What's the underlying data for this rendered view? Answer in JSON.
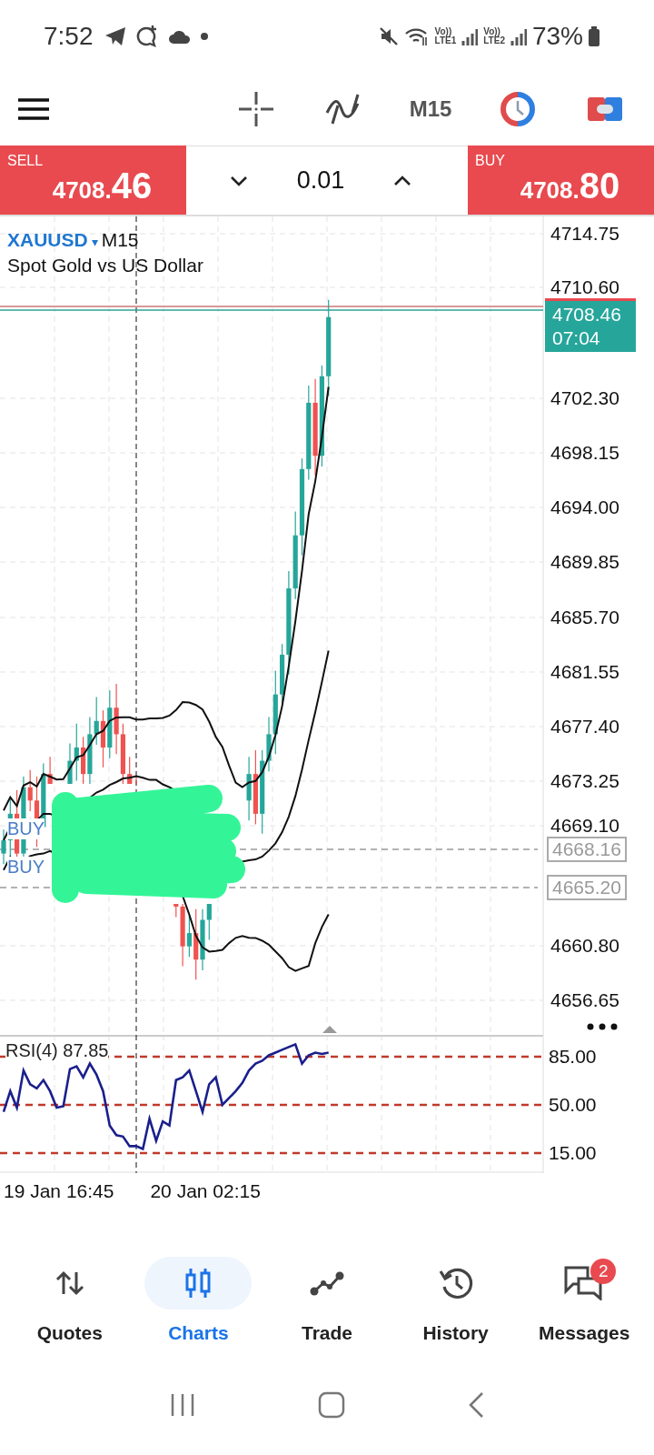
{
  "status_bar": {
    "time": "7:52",
    "sims": [
      {
        "volte": "Vo))",
        "network": "LTE1"
      },
      {
        "volte": "Vo))",
        "network": "LTE2"
      }
    ],
    "battery": "73%"
  },
  "toolbar": {
    "timeframe": "M15"
  },
  "trade_bar": {
    "sell": {
      "label": "SELL",
      "price_prefix": "4708.",
      "price_pips": "46"
    },
    "volume": "0.01",
    "buy": {
      "label": "BUY",
      "price_prefix": "4708.",
      "price_pips": "80"
    }
  },
  "chart": {
    "symbol": "XAUUSD",
    "dropdown": "▾",
    "timeframe": "M15",
    "description": "Spot Gold vs US Dollar",
    "price_axis": [
      "4714.75",
      "4710.60",
      "4702.30",
      "4698.15",
      "4694.00",
      "4689.85",
      "4685.70",
      "4681.55",
      "4677.40",
      "4673.25",
      "4669.10",
      "4660.80",
      "4656.65"
    ],
    "current_price": {
      "price": "4708.46",
      "countdown": "07:04"
    },
    "orders": [
      {
        "label": "BUY",
        "price": "4668.16"
      },
      {
        "label": "BUY",
        "price": "4665.20"
      }
    ]
  },
  "rsi": {
    "label": "RSI(4) 87.85",
    "levels": [
      "85.00",
      "50.00",
      "15.00"
    ]
  },
  "time_axis": [
    "19 Jan 16:45",
    "20 Jan 02:15"
  ],
  "nav": [
    {
      "kind": "quotes",
      "label": "Quotes",
      "selected": false
    },
    {
      "kind": "charts",
      "label": "Charts",
      "selected": true
    },
    {
      "kind": "trade",
      "label": "Trade",
      "selected": false
    },
    {
      "kind": "history",
      "label": "History",
      "selected": false
    },
    {
      "kind": "messages",
      "label": "Messages",
      "selected": false,
      "badge": "2"
    }
  ]
}
